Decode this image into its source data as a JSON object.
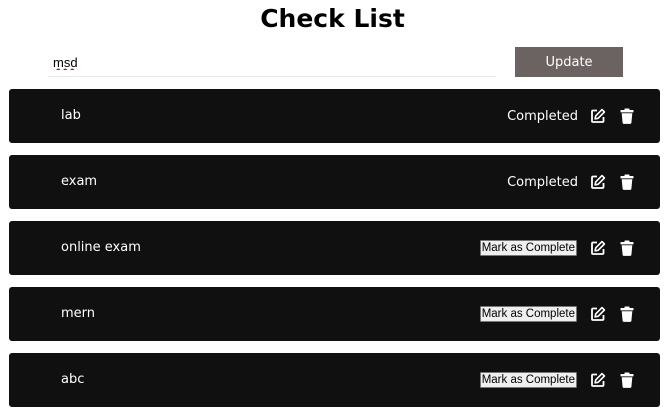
{
  "app": {
    "title": "Check List"
  },
  "input": {
    "value": "msd"
  },
  "update_button": {
    "label": "Update"
  },
  "items": [
    {
      "text": "lab",
      "status": "completed",
      "status_label": "Completed"
    },
    {
      "text": "exam",
      "status": "completed",
      "status_label": "Completed"
    },
    {
      "text": "online exam",
      "status": "pending",
      "action_label": "Mark as Complete"
    },
    {
      "text": "mern",
      "status": "pending",
      "action_label": "Mark as Complete"
    },
    {
      "text": "abc",
      "status": "pending",
      "action_label": "Mark as Complete"
    }
  ],
  "icons": {
    "edit": "pencil-square-icon",
    "delete": "trash-icon"
  },
  "colors": {
    "item_bg": "#101010",
    "update_button_bg": "#6b6262"
  }
}
